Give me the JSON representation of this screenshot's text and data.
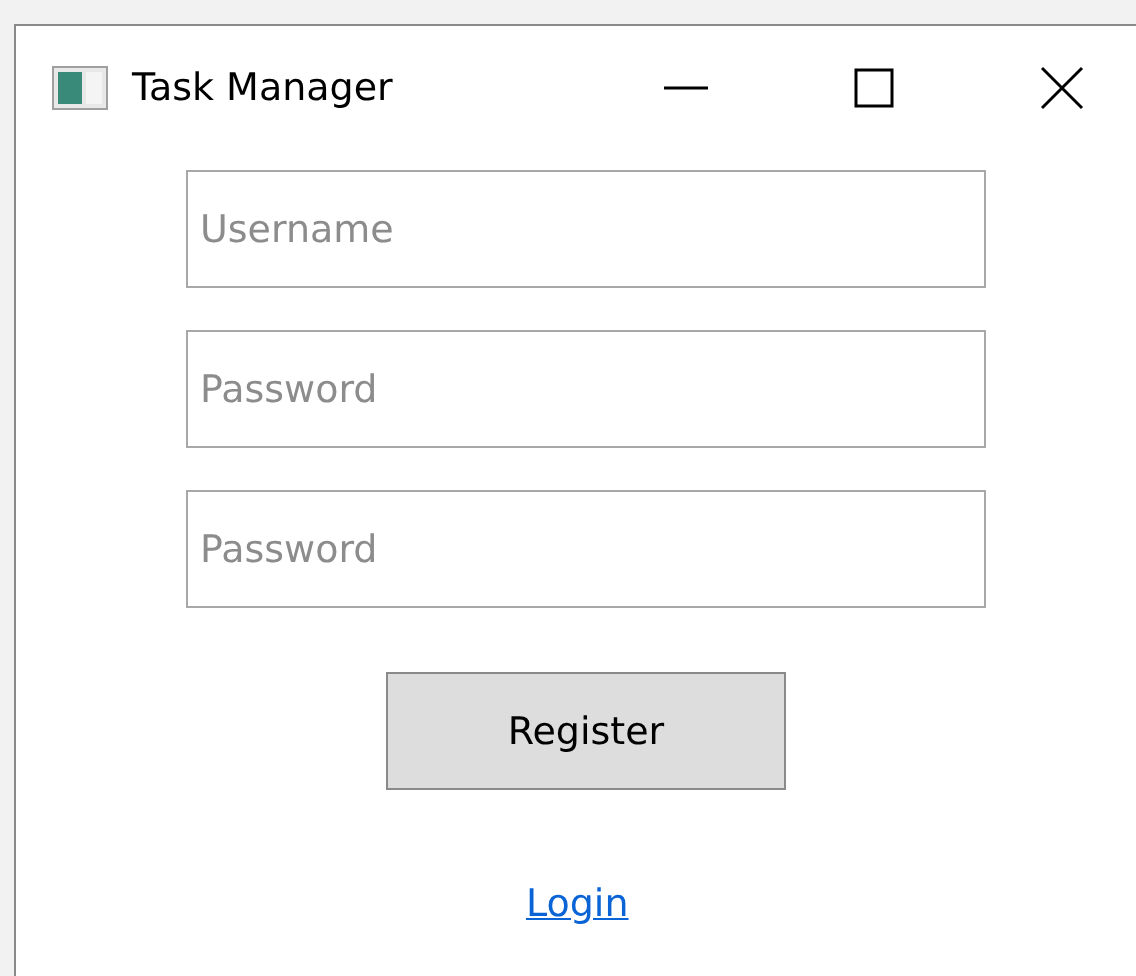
{
  "window": {
    "title": "Task Manager"
  },
  "fields": [
    {
      "placeholder": "Username"
    },
    {
      "placeholder": "Password"
    },
    {
      "placeholder": "Password"
    }
  ],
  "register_button": "Register",
  "login_link": "Login"
}
